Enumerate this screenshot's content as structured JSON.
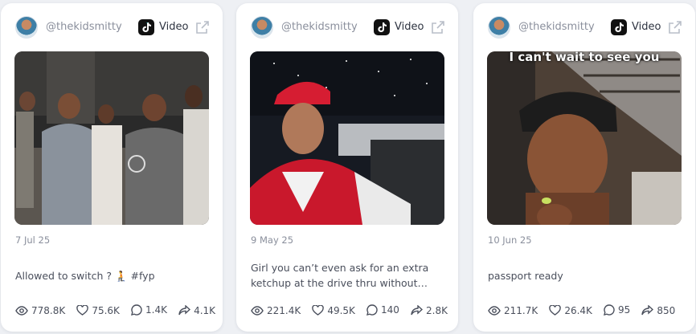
{
  "cards": [
    {
      "handle": "@thekidsmitty",
      "source_label": "Video",
      "platform_icon": "tiktok-icon",
      "external_icon": "external-link-icon",
      "overlay_text": "",
      "date": "7 Jul 25",
      "caption": "Allowed to switch ? 🧎 #fyp",
      "stats": {
        "views": "778.8K",
        "likes": "75.6K",
        "comments": "1.4K",
        "shares": "4.1K"
      }
    },
    {
      "handle": "@thekidsmitty",
      "source_label": "Video",
      "platform_icon": "tiktok-icon",
      "external_icon": "external-link-icon",
      "overlay_text": "",
      "date": "9 May 25",
      "caption": "Girl you can’t even ask for an extra ketchup at the drive thru without feeling…",
      "stats": {
        "views": "221.4K",
        "likes": "49.5K",
        "comments": "140",
        "shares": "2.8K"
      }
    },
    {
      "handle": "@thekidsmitty",
      "source_label": "Video",
      "platform_icon": "tiktok-icon",
      "external_icon": "external-link-icon",
      "overlay_text": "I can't wait to see you",
      "date": "10 Jun 25",
      "caption": "passport ready",
      "stats": {
        "views": "211.7K",
        "likes": "26.4K",
        "comments": "95",
        "shares": "850"
      }
    }
  ],
  "colors": {
    "card_bg": "#ffffff",
    "page_bg": "#eef0f4",
    "muted_text": "#8a8f9c",
    "body_text": "#4a4f5c"
  }
}
